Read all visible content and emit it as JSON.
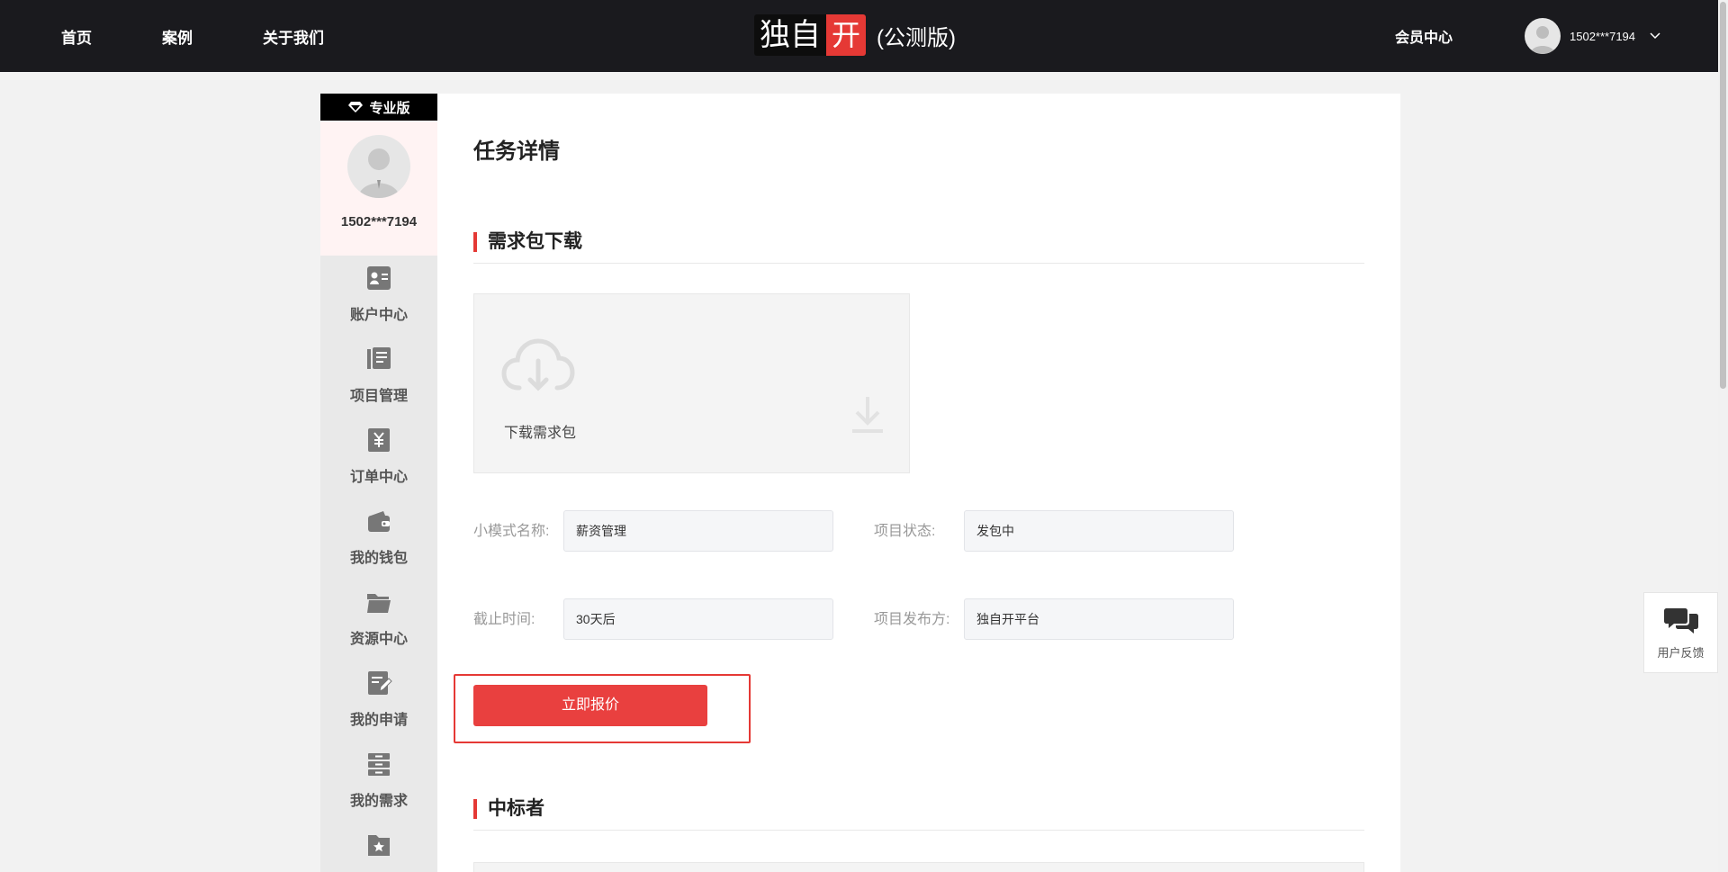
{
  "nav": {
    "links": [
      "首页",
      "案例",
      "关于我们"
    ],
    "logo_left": "独自",
    "logo_right": "开",
    "logo_sub": "(公测版)",
    "member_center": "会员中心",
    "user_name": "1502***7194"
  },
  "sidebar": {
    "badge": "专业版",
    "user_name": "1502***7194",
    "items": [
      {
        "label": "账户中心",
        "icon": "id-card-icon"
      },
      {
        "label": "项目管理",
        "icon": "project-list-icon"
      },
      {
        "label": "订单中心",
        "icon": "yen-receipt-icon"
      },
      {
        "label": "我的钱包",
        "icon": "wallet-icon"
      },
      {
        "label": "资源中心",
        "icon": "folder-icon"
      },
      {
        "label": "我的申请",
        "icon": "edit-note-icon"
      },
      {
        "label": "我的需求",
        "icon": "cabinet-icon"
      },
      {
        "label": "",
        "icon": "star-folder-icon"
      }
    ]
  },
  "main": {
    "title": "任务详情",
    "section_download": "需求包下载",
    "download_label": "下载需求包",
    "fields": {
      "module_name_label": "小模式名称:",
      "module_name_value": "薪资管理",
      "status_label": "项目状态:",
      "status_value": "发包中",
      "deadline_label": "截止时间:",
      "deadline_value": "30天后",
      "publisher_label": "项目发布方:",
      "publisher_value": "独自开平台"
    },
    "quote_button": "立即报价",
    "section_winner": "中标者"
  },
  "feedback": {
    "label": "用户反馈"
  },
  "colors": {
    "accent": "#e53935",
    "nav_bg": "#1a1a1e"
  }
}
